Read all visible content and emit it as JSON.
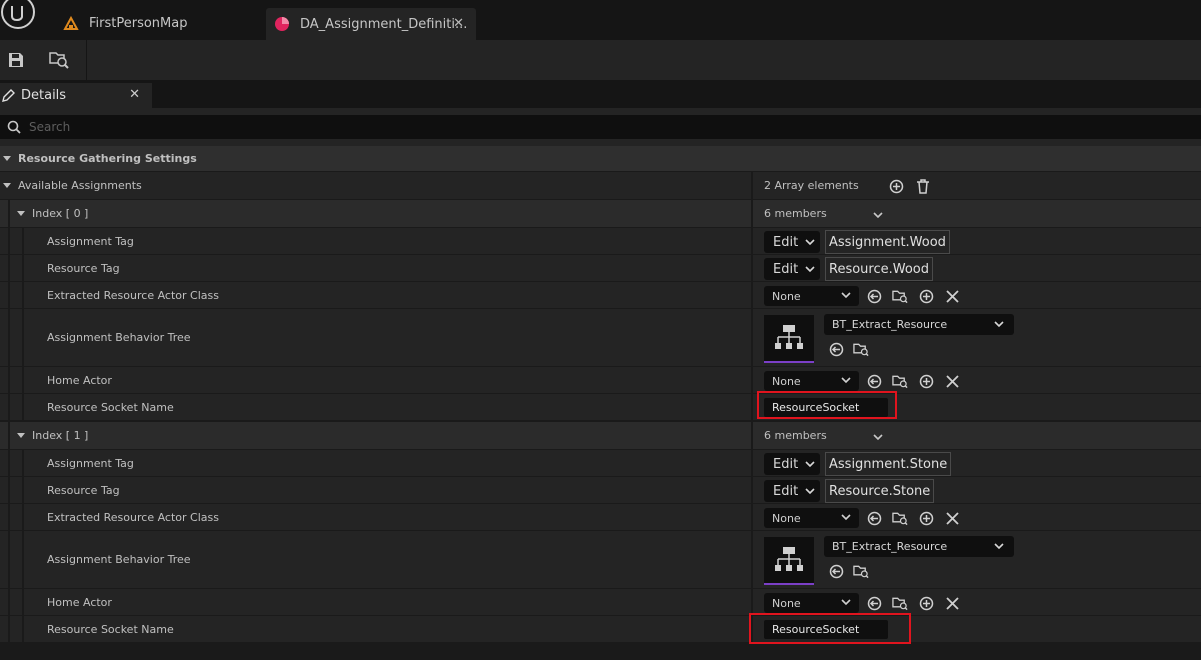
{
  "tabs": [
    {
      "label": "FirstPersonMap"
    },
    {
      "label": "DA_Assignment_Definiti..."
    }
  ],
  "details_tab": {
    "label": "Details"
  },
  "search": {
    "placeholder": "Search"
  },
  "category": {
    "label": "Resource Gathering Settings"
  },
  "available": {
    "label": "Available Assignments",
    "value": "2 Array elements"
  },
  "indices": [
    {
      "label": "Index [ 0 ]",
      "members": "6 members",
      "props": {
        "assignment_tag_label": "Assignment Tag",
        "assignment_tag_value": "Assignment.Wood",
        "resource_tag_label": "Resource Tag",
        "resource_tag_value": "Resource.Wood",
        "extracted_label": "Extracted Resource Actor Class",
        "extracted_value": "None",
        "bt_label": "Assignment Behavior Tree",
        "bt_value": "BT_Extract_Resource",
        "home_label": "Home Actor",
        "home_value": "None",
        "socket_label": "Resource Socket Name",
        "socket_value": "ResourceSocket"
      }
    },
    {
      "label": "Index [ 1 ]",
      "members": "6 members",
      "props": {
        "assignment_tag_label": "Assignment Tag",
        "assignment_tag_value": "Assignment.Stone",
        "resource_tag_label": "Resource Tag",
        "resource_tag_value": "Resource.Stone",
        "extracted_label": "Extracted Resource Actor Class",
        "extracted_value": "None",
        "bt_label": "Assignment Behavior Tree",
        "bt_value": "BT_Extract_Resource",
        "home_label": "Home Actor",
        "home_value": "None",
        "socket_label": "Resource Socket Name",
        "socket_value": "ResourceSocket"
      }
    }
  ],
  "edit_label": "Edit",
  "colors": {
    "highlight": "#e0141e",
    "asset_icon": "#e0245e",
    "map_icon": "#e08a1e",
    "thumb_accent": "#7b3fc7"
  }
}
